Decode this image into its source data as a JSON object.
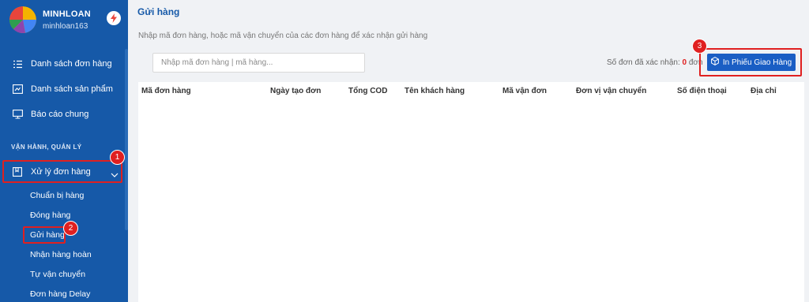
{
  "user": {
    "name": "MINHLOAN",
    "username": "minhloan163"
  },
  "sidebar": {
    "items": [
      {
        "label": "Danh sách đơn hàng",
        "icon": "list-icon"
      },
      {
        "label": "Danh sách sản phẩm",
        "icon": "product-icon"
      },
      {
        "label": "Báo cáo chung",
        "icon": "monitor-icon"
      }
    ],
    "section_title": "VẬN HÀNH, QUẢN LÝ",
    "group": {
      "label": "Xử lý đơn hàng",
      "icon": "book-icon"
    },
    "subitems": [
      "Chuẩn bị hàng",
      "Đóng hàng",
      "Gửi hàng",
      "Nhận hàng hoàn",
      "Tự vận chuyển",
      "Đơn hàng Delay"
    ]
  },
  "page": {
    "title": "Gửi hàng",
    "hint": "Nhập mã đơn hàng, hoặc mã vận chuyển của các đơn hàng để xác nhận gửi hàng",
    "search_placeholder": "Nhập mã đơn hàng | mã hàng...",
    "confirm_label": "Số đơn đã xác nhận:",
    "confirm_count": "0",
    "confirm_unit": "đơn",
    "print_button": "In Phiếu Giao Hàng"
  },
  "table": {
    "columns": [
      "Mã đơn hàng",
      "Ngày tạo đơn",
      "Tổng COD",
      "Tên khách hàng",
      "Mã vận đơn",
      "Đơn vị vận chuyển",
      "Số điện thoại",
      "Địa chỉ"
    ]
  },
  "annotations": [
    "1",
    "2",
    "3"
  ],
  "colors": {
    "sidebar": "#1659a8",
    "accent": "#1a5ec4",
    "highlight": "#e02020"
  }
}
